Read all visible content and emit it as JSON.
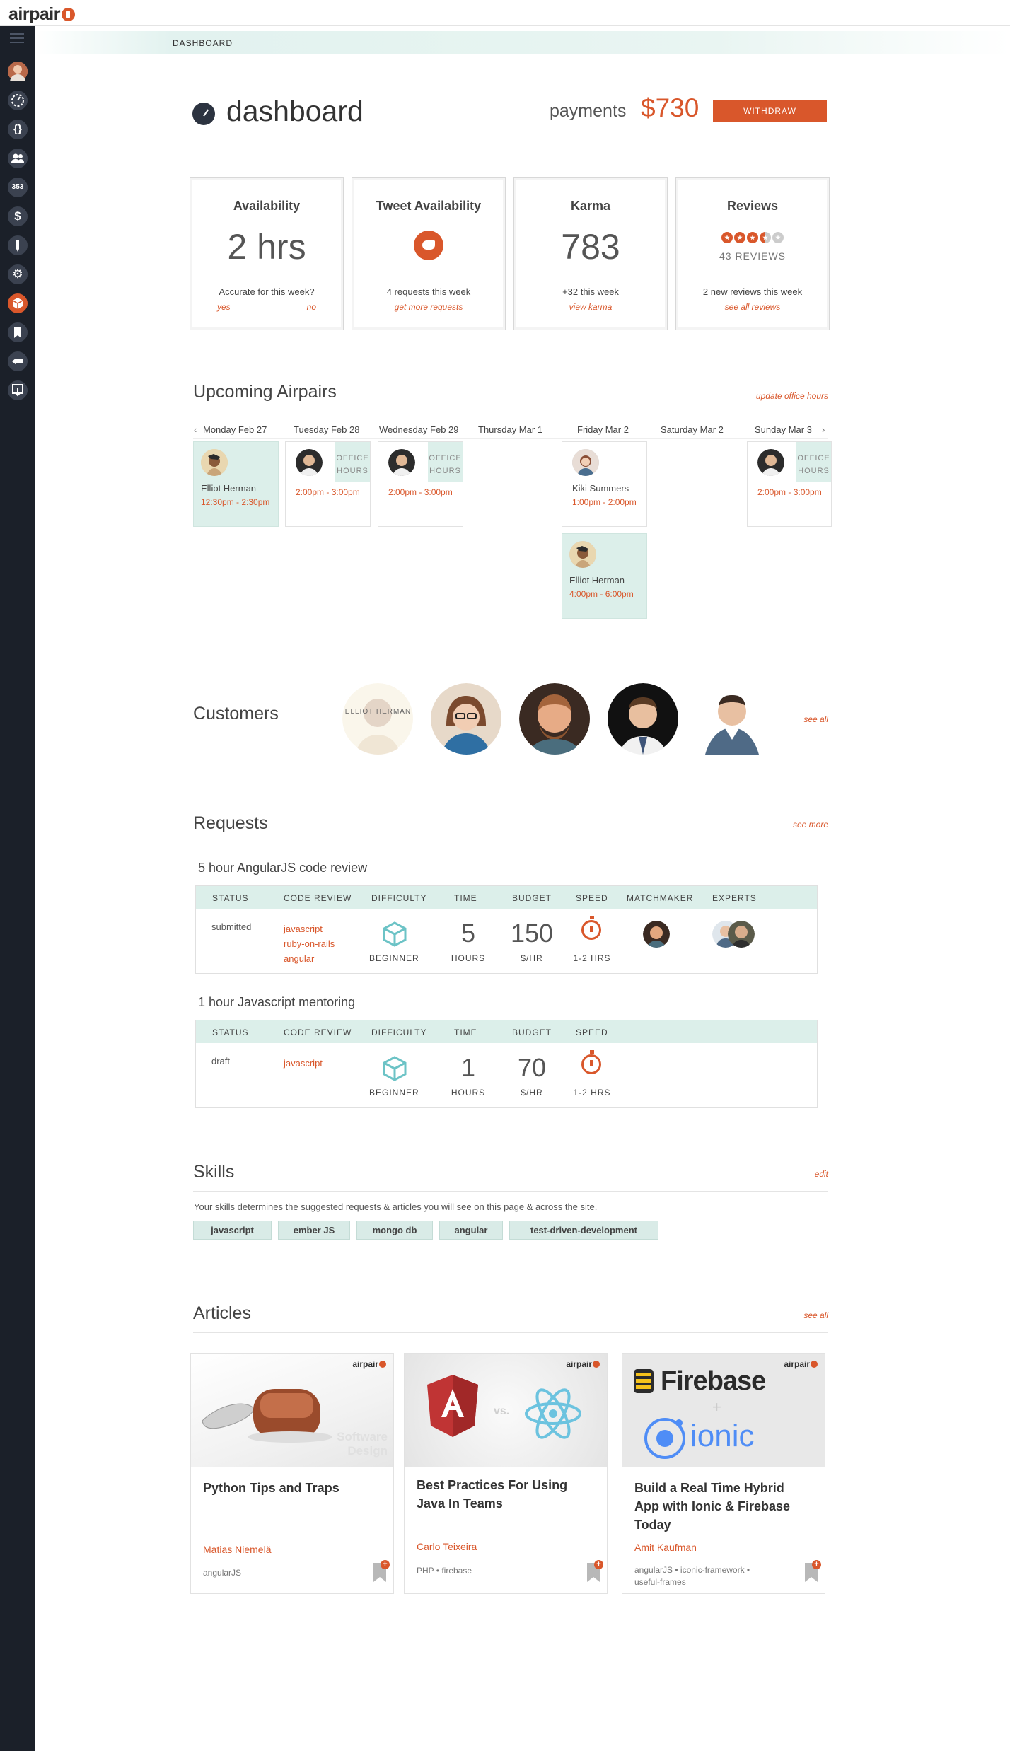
{
  "app": {
    "logo": "airpair"
  },
  "sidebar": {
    "items": [
      {
        "icon": "menu-icon"
      },
      {
        "icon": "avatar"
      },
      {
        "icon": "dashboard-icon"
      },
      {
        "icon": "code-braces-icon"
      },
      {
        "icon": "users-icon"
      },
      {
        "icon": "badge-count",
        "label": "353"
      },
      {
        "icon": "dollar-icon"
      },
      {
        "icon": "pen-icon"
      },
      {
        "icon": "gear-icon"
      },
      {
        "icon": "cube-icon"
      },
      {
        "icon": "bookmark-icon"
      },
      {
        "icon": "back-icon"
      },
      {
        "icon": "download-icon"
      }
    ]
  },
  "breadcrumb": "DASHBOARD",
  "header": {
    "title": "dashboard",
    "payments_label": "payments",
    "payments_amount": "$730",
    "withdraw_label": "WITHDRAW"
  },
  "cards": [
    {
      "title": "Availability",
      "value": "2 hrs",
      "subtitle": "Accurate for this week?",
      "links": [
        "yes",
        "no"
      ]
    },
    {
      "title": "Tweet Availability",
      "subtitle": "4 requests this week",
      "links": [
        "get more requests"
      ]
    },
    {
      "title": "Karma",
      "value": "783",
      "subtitle": "+32 this week",
      "links": [
        "view karma"
      ]
    },
    {
      "title": "Reviews",
      "rating": 3.5,
      "count_label": "43 REVIEWS",
      "subtitle": "2 new reviews this week",
      "links": [
        "see all reviews"
      ]
    }
  ],
  "upcoming": {
    "title": "Upcoming Airpairs",
    "link": "update office hours",
    "days": [
      "Monday Feb 27",
      "Tuesday Feb 28",
      "Wednesday Feb 29",
      "Thursday Mar 1",
      "Friday Mar 2",
      "Saturday Mar 2",
      "Sunday Mar 3"
    ],
    "office_hours_label": "OFFICE HOURS",
    "slots": [
      {
        "name": "Elliot Herman",
        "time": "12:30pm - 2:30pm"
      },
      {
        "time": "2:00pm - 3:00pm"
      },
      {
        "time": "2:00pm - 3:00pm"
      },
      {
        "name": "Kiki Summers",
        "time": "1:00pm - 2:00pm"
      },
      {
        "name": "Elliot Herman",
        "time": "4:00pm - 6:00pm"
      },
      {
        "time": "2:00pm - 3:00pm"
      }
    ]
  },
  "customers": {
    "title": "Customers",
    "link": "see all",
    "hover_name": "ELLIOT HERMAN"
  },
  "requests": {
    "title": "Requests",
    "link": "see more",
    "columns": [
      "STATUS",
      "CODE REVIEW",
      "DIFFICULTY",
      "TIME",
      "BUDGET",
      "SPEED",
      "MATCHMAKER",
      "EXPERTS"
    ],
    "items": [
      {
        "title": "5 hour AngularJS code review",
        "status": "submitted",
        "tags": [
          "javascript",
          "ruby-on-rails",
          "angular"
        ],
        "difficulty": "BEGINNER",
        "time": "5",
        "time_unit": "HOURS",
        "budget": "150",
        "budget_unit": "$/HR",
        "speed": "1-2 HRS"
      },
      {
        "title": "1 hour Javascript mentoring",
        "status": "draft",
        "tags": [
          "javascript"
        ],
        "difficulty": "BEGINNER",
        "time": "1",
        "time_unit": "HOURS",
        "budget": "70",
        "budget_unit": "$/HR",
        "speed": "1-2 HRS"
      }
    ]
  },
  "skills": {
    "title": "Skills",
    "link": "edit",
    "description": "Your skills determines the suggested requests & articles you will see on this page & across the site.",
    "items": [
      "javascript",
      "ember JS",
      "mongo db",
      "angular",
      "test-driven-development"
    ]
  },
  "articles": {
    "title": "Articles",
    "link": "see all",
    "brand": "airpair",
    "items": [
      {
        "title": "Python Tips and Traps",
        "author": "Matias Niemelä",
        "tags": "angularJS",
        "image_text": "Software Design"
      },
      {
        "title": "Best Practices For Using Java In Teams",
        "author": "Carlo Teixeira",
        "tags": "PHP • firebase",
        "image_text": "vs."
      },
      {
        "title": "Build a Real Time Hybrid App with Ionic & Firebase Today",
        "author": "Amit Kaufman",
        "tags": "angularJS • iconic-framework • useful-frames",
        "image_text": "Firebase",
        "image_text2": "ionic"
      }
    ]
  },
  "colors": {
    "accent": "#d9572b",
    "teal": "#dcefea",
    "sidebar": "#1b2029"
  }
}
